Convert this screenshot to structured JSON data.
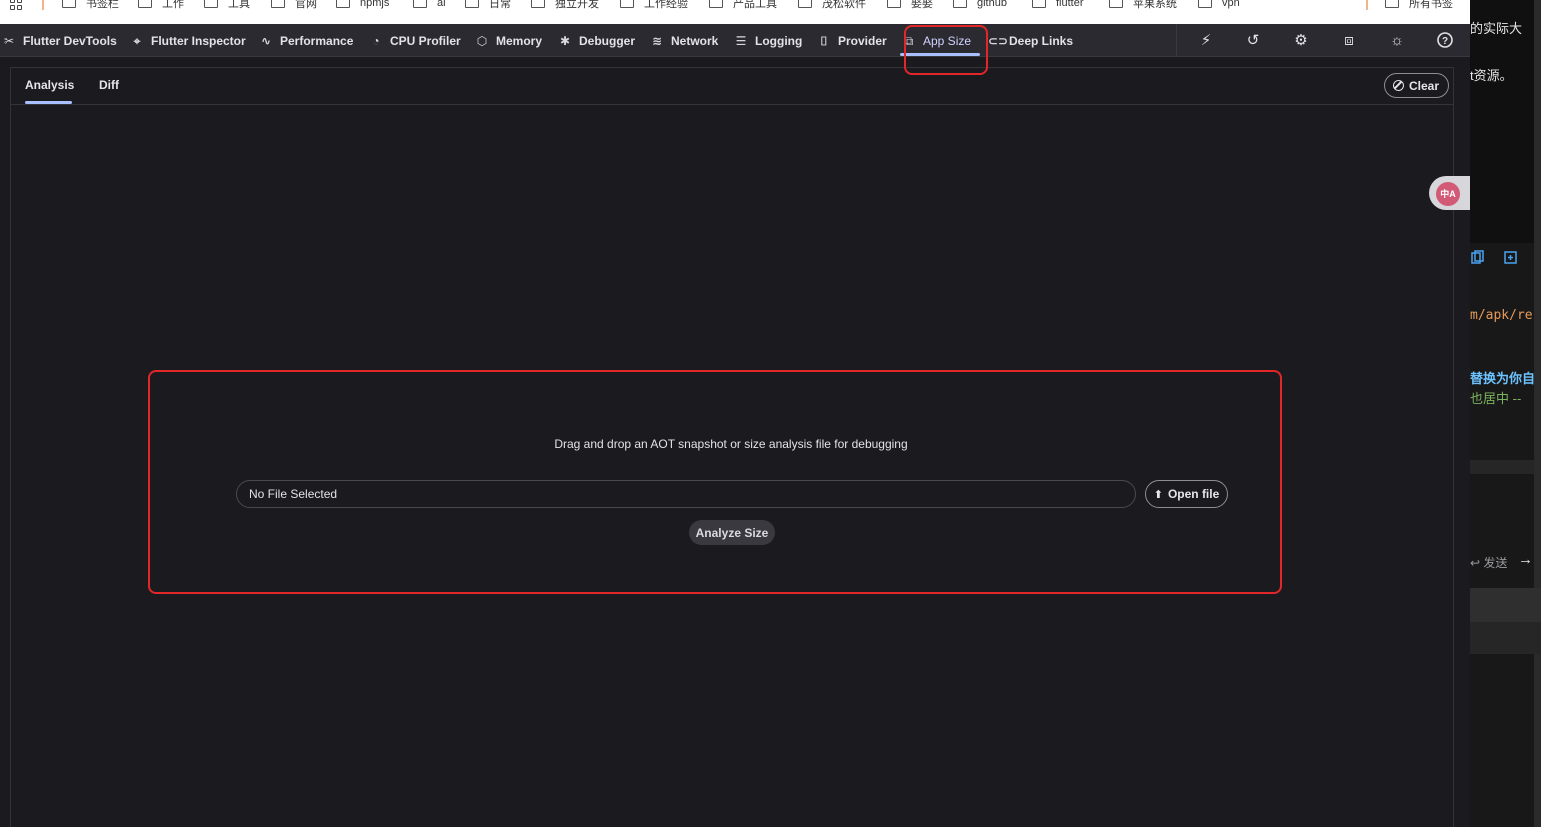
{
  "bookmarks": {
    "items": [
      "书签栏",
      "工作",
      "工具",
      "官网",
      "npmjs",
      "ai",
      "日常",
      "独立开发",
      "工作经验",
      "产品工具",
      "茂松软件",
      "娶娶",
      "github",
      "flutter",
      "苹果系统",
      "vpn"
    ],
    "all_bookmarks": "所有书签"
  },
  "side_panel": {
    "line1": "的实际大",
    "line2": "t资源。",
    "code1": "m/apk/re",
    "line3": "替换为你自",
    "line4": "也居中 --",
    "send_label": "↩ 发送"
  },
  "devtools": {
    "tabs": [
      {
        "label": "Flutter DevTools",
        "icon": "flutter-devtools-icon"
      },
      {
        "label": "Flutter Inspector",
        "icon": "inspector-icon"
      },
      {
        "label": "Performance",
        "icon": "performance-icon"
      },
      {
        "label": "CPU Profiler",
        "icon": "cpu-profiler-icon"
      },
      {
        "label": "Memory",
        "icon": "memory-icon"
      },
      {
        "label": "Debugger",
        "icon": "debugger-icon"
      },
      {
        "label": "Network",
        "icon": "network-icon"
      },
      {
        "label": "Logging",
        "icon": "logging-icon"
      },
      {
        "label": "Provider",
        "icon": "provider-icon"
      },
      {
        "label": "App Size",
        "icon": "app-size-icon"
      },
      {
        "label": "Deep Links",
        "icon": "deep-links-icon"
      }
    ],
    "selected_tab": "App Size",
    "actions": [
      "hot-reload-icon",
      "hot-restart-icon",
      "settings-icon",
      "extensions-icon",
      "debug-icon",
      "help-icon"
    ],
    "subtabs": {
      "analysis": "Analysis",
      "diff": "Diff"
    },
    "clear_label": "Clear",
    "drop_text": "Drag and drop an AOT snapshot or size analysis file for debugging",
    "file_field": "No File Selected",
    "open_file_label": "Open file",
    "analyze_label": "Analyze Size"
  },
  "translate_badge": "中A",
  "colors": {
    "background": "#1b1a1f",
    "toolbar": "#2b2a30",
    "accent": "#a9c0ff",
    "annotation": "#e3262a"
  }
}
